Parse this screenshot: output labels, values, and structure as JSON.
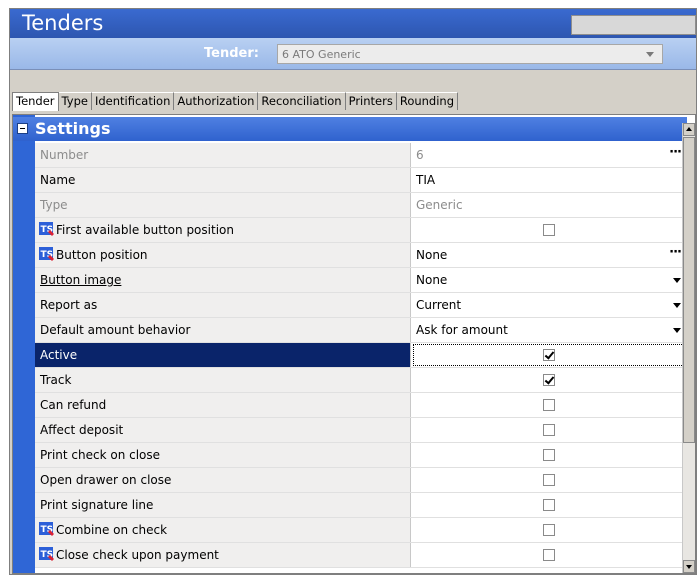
{
  "window": {
    "title": "Tenders"
  },
  "tender": {
    "label": "Tender:",
    "value": "6 ATO Generic"
  },
  "tabs": [
    {
      "label": "Tender"
    },
    {
      "label": "Type"
    },
    {
      "label": "Identification"
    },
    {
      "label": "Authorization"
    },
    {
      "label": "Reconciliation"
    },
    {
      "label": "Printers"
    },
    {
      "label": "Rounding"
    }
  ],
  "section": {
    "title": "Settings"
  },
  "rows": [
    {
      "name": "Number",
      "value": "6"
    },
    {
      "name": "Name",
      "value": "TIA"
    },
    {
      "name": "Type",
      "value": "Generic"
    },
    {
      "name": "First available button position"
    },
    {
      "name": "Button position",
      "value": "None"
    },
    {
      "name": "Button image",
      "value": "None"
    },
    {
      "name": "Report as",
      "value": "Current"
    },
    {
      "name": "Default amount behavior",
      "value": "Ask for amount"
    },
    {
      "name": "Active"
    },
    {
      "name": "Track"
    },
    {
      "name": "Can refund"
    },
    {
      "name": "Affect deposit"
    },
    {
      "name": "Print check on close"
    },
    {
      "name": "Open drawer on close"
    },
    {
      "name": "Print signature line"
    },
    {
      "name": "Combine on check"
    },
    {
      "name": "Close check upon payment"
    }
  ],
  "icons": {
    "ts": "ts-icon",
    "ellipsis": "ellipsis-icon",
    "dropdown": "chevron-down-icon"
  },
  "colors": {
    "header_blue": "#3864c0",
    "selected": "#0a246a"
  }
}
